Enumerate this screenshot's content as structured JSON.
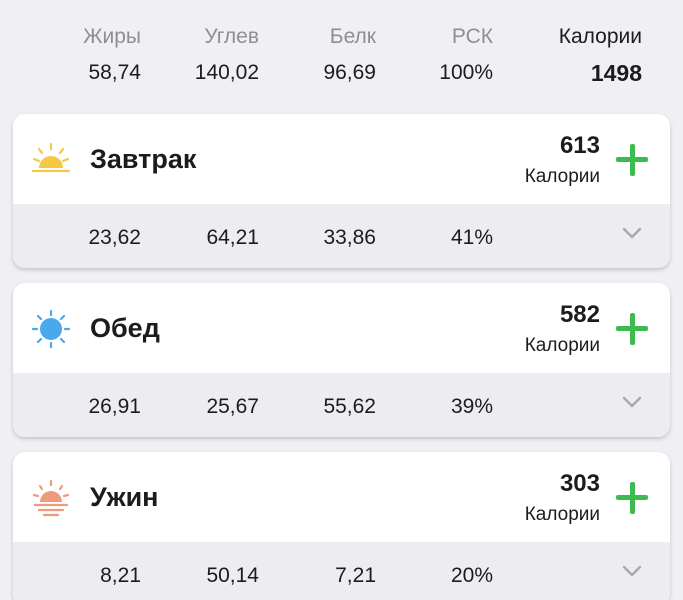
{
  "summary": {
    "fat": {
      "label": "Жиры",
      "value": "58,74"
    },
    "carbs": {
      "label": "Углев",
      "value": "140,02"
    },
    "protein": {
      "label": "Белк",
      "value": "96,69"
    },
    "rsk": {
      "label": "РСК",
      "value": "100%"
    },
    "calories": {
      "label": "Калории",
      "value": "1498"
    }
  },
  "meals": [
    {
      "icon": "sunrise-icon",
      "title": "Завтрак",
      "calories": "613",
      "calories_label": "Калории",
      "fat": "23,62",
      "carbs": "64,21",
      "protein": "33,86",
      "rsk": "41%"
    },
    {
      "icon": "sun-icon",
      "title": "Обед",
      "calories": "582",
      "calories_label": "Калории",
      "fat": "26,91",
      "carbs": "25,67",
      "protein": "55,62",
      "rsk": "39%"
    },
    {
      "icon": "sunset-icon",
      "title": "Ужин",
      "calories": "303",
      "calories_label": "Калории",
      "fat": "8,21",
      "carbs": "50,14",
      "protein": "7,21",
      "rsk": "20%"
    }
  ],
  "colors": {
    "background": "#efeff4",
    "accent_green": "#3dbb4e",
    "sunrise": "#f5c842",
    "sun": "#4aa8ec",
    "sunset": "#ee9a7c",
    "secondary_text": "#8e8e93"
  }
}
